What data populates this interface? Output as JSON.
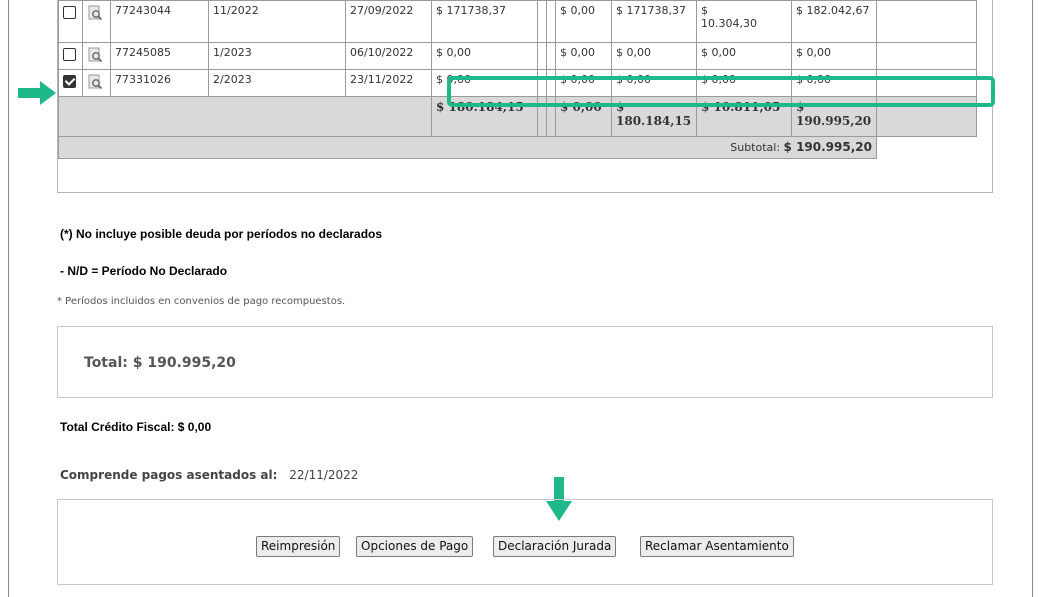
{
  "rows": [
    {
      "checked": false,
      "id": "77243044",
      "period": "11/2022",
      "date": "27/09/2022",
      "c1": "$ 171738,37",
      "c3": "$ 0,00",
      "c4": "$ 171738,37",
      "c5": "$\n10.304,30",
      "c6": "$ 182.042,67"
    },
    {
      "checked": false,
      "id": "77245085",
      "period": "1/2023",
      "date": "06/10/2022",
      "c1": "$ 0,00",
      "c3": "$ 0,00",
      "c4": "$ 0,00",
      "c5": "$ 0,00",
      "c6": "$ 0,00"
    },
    {
      "checked": true,
      "id": "77331026",
      "period": "2/2023",
      "date": "23/11/2022",
      "c1": "$ 0,00",
      "c3": "$ 0,00",
      "c4": "$ 0,00",
      "c5": "$ 0,00",
      "c6": "$ 0,00"
    }
  ],
  "totals": {
    "c1": "$ 180.184,15",
    "c3": "$ 0,00",
    "c4": "$ 180.184,15",
    "c5": "$ 10.811,05",
    "c6": "$ 190.995,20"
  },
  "subtotal": {
    "label": "Subtotal:",
    "value": "$ 190.995,20"
  },
  "notes": {
    "no_incluye": "(*) No incluye posible deuda por períodos no declarados",
    "nd": "- N/D = Período No Declarado",
    "convenios": "* Períodos incluidos en convenios de pago recompuestos."
  },
  "total_box": "Total: $ 190.995,20",
  "credito_fiscal": "Total Crédito Fiscal: $ 0,00",
  "comprende": {
    "label": "Comprende pagos asentados al:",
    "value": "22/11/2022"
  },
  "buttons": {
    "reimpresion": "Reimpresión",
    "opciones": "Opciones de Pago",
    "declaracion": "Declaración Jurada",
    "reclamar": "Reclamar Asentamiento"
  },
  "colors": {
    "highlight": "#1fb88a",
    "arrow": "#1fb88a"
  }
}
